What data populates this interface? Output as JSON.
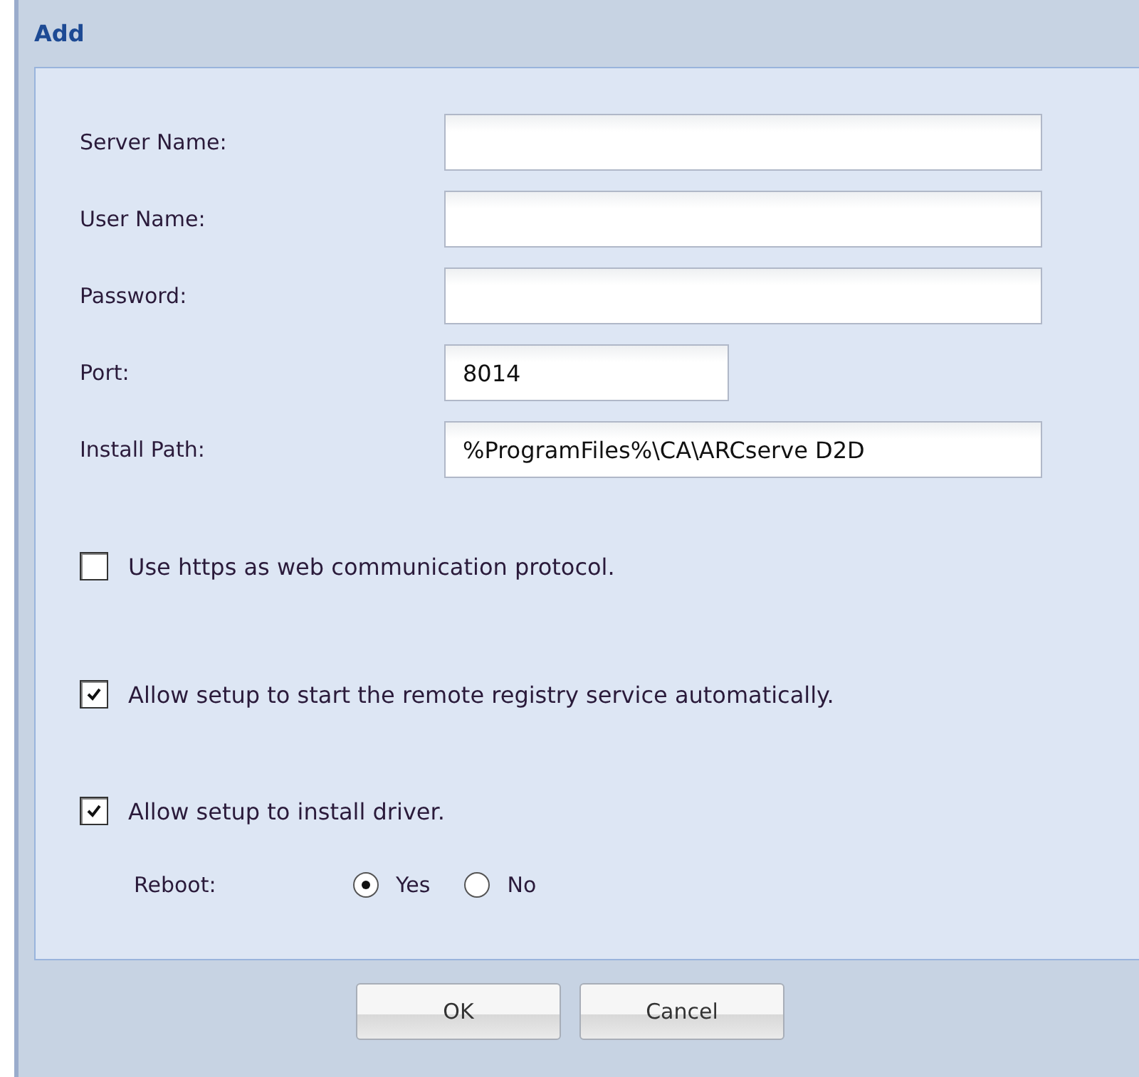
{
  "window": {
    "title": "Add"
  },
  "fields": [
    {
      "label": "Server Name:",
      "kind": "wide"
    },
    {
      "label": "User Name:",
      "kind": "wide"
    },
    {
      "label": "Password:",
      "kind": "wide"
    },
    {
      "label": "Port:",
      "value": "8014",
      "kind": "short"
    },
    {
      "label": "Install Path:",
      "value": "%ProgramFiles%\\CA\\ARCserve D2D",
      "kind": "wide"
    }
  ],
  "options": [
    {
      "label": "Use https as web communication protocol.",
      "checked": false
    },
    {
      "label": "Allow setup to start the remote registry service automatically.",
      "checked": true
    },
    {
      "label": "Allow setup to install driver.",
      "checked": true
    }
  ],
  "reboot": {
    "label": "Reboot:",
    "choices": [
      {
        "label": "Yes",
        "selected": true
      },
      {
        "label": "No",
        "selected": false
      }
    ]
  },
  "buttons": [
    "OK",
    "Cancel"
  ]
}
